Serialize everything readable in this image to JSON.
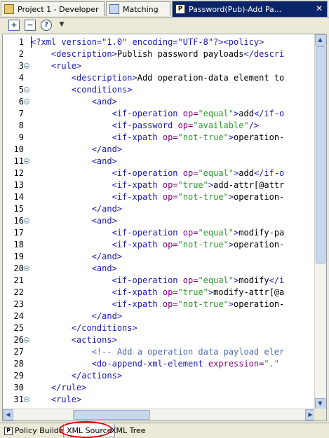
{
  "tabs": [
    {
      "label": "Project 1 - Developer",
      "icon": "project-icon"
    },
    {
      "label": "Matching",
      "icon": "matching-icon"
    },
    {
      "label": "Password(Pub)-Add Pa...",
      "icon": "policy-icon",
      "active": true
    }
  ],
  "toolbar": {
    "icons": [
      "expand-all-icon",
      "collapse-all-icon",
      "help-icon",
      "view-menu-icon"
    ]
  },
  "editor": {
    "lines": [
      {
        "n": "1",
        "fold": false
      },
      {
        "n": "2",
        "fold": false
      },
      {
        "n": "3",
        "fold": true
      },
      {
        "n": "4",
        "fold": false
      },
      {
        "n": "5",
        "fold": true
      },
      {
        "n": "6",
        "fold": true
      },
      {
        "n": "7",
        "fold": false
      },
      {
        "n": "8",
        "fold": false
      },
      {
        "n": "9",
        "fold": false
      },
      {
        "n": "10",
        "fold": false
      },
      {
        "n": "11",
        "fold": true
      },
      {
        "n": "12",
        "fold": false
      },
      {
        "n": "13",
        "fold": false
      },
      {
        "n": "14",
        "fold": false
      },
      {
        "n": "15",
        "fold": false
      },
      {
        "n": "16",
        "fold": true
      },
      {
        "n": "17",
        "fold": false
      },
      {
        "n": "18",
        "fold": false
      },
      {
        "n": "19",
        "fold": false
      },
      {
        "n": "20",
        "fold": true
      },
      {
        "n": "21",
        "fold": false
      },
      {
        "n": "22",
        "fold": false
      },
      {
        "n": "23",
        "fold": false
      },
      {
        "n": "24",
        "fold": false
      },
      {
        "n": "25",
        "fold": false
      },
      {
        "n": "26",
        "fold": true
      },
      {
        "n": "27",
        "fold": false
      },
      {
        "n": "28",
        "fold": false
      },
      {
        "n": "29",
        "fold": false
      },
      {
        "n": "30",
        "fold": false
      },
      {
        "n": "31",
        "fold": true
      }
    ],
    "code": [
      [
        [
          "t",
          "<?xml version=\"1.0\" encoding=\"UTF-8\"?><policy>"
        ]
      ],
      [
        [
          "s",
          "    "
        ],
        [
          "t",
          "<description>"
        ],
        [
          "x",
          "Publish password payloads"
        ],
        [
          "t",
          "</descri"
        ]
      ],
      [
        [
          "s",
          "    "
        ],
        [
          "t",
          "<rule>"
        ]
      ],
      [
        [
          "s",
          "        "
        ],
        [
          "t",
          "<description>"
        ],
        [
          "x",
          "Add operation-data element to"
        ]
      ],
      [
        [
          "s",
          "        "
        ],
        [
          "t",
          "<conditions>"
        ]
      ],
      [
        [
          "s",
          "            "
        ],
        [
          "t",
          "<and>"
        ]
      ],
      [
        [
          "s",
          "                "
        ],
        [
          "t",
          "<if-operation "
        ],
        [
          "a",
          "op="
        ],
        [
          "v",
          "\"equal\""
        ],
        [
          "t",
          ">"
        ],
        [
          "x",
          "add"
        ],
        [
          "t",
          "</if-o"
        ]
      ],
      [
        [
          "s",
          "                "
        ],
        [
          "t",
          "<if-password "
        ],
        [
          "a",
          "op="
        ],
        [
          "v",
          "\"available\""
        ],
        [
          "t",
          "/>"
        ]
      ],
      [
        [
          "s",
          "                "
        ],
        [
          "t",
          "<if-xpath "
        ],
        [
          "a",
          "op="
        ],
        [
          "v",
          "\"not-true\""
        ],
        [
          "t",
          ">"
        ],
        [
          "x",
          "operation-"
        ]
      ],
      [
        [
          "s",
          "            "
        ],
        [
          "t",
          "</and>"
        ]
      ],
      [
        [
          "s",
          "            "
        ],
        [
          "t",
          "<and>"
        ]
      ],
      [
        [
          "s",
          "                "
        ],
        [
          "t",
          "<if-operation "
        ],
        [
          "a",
          "op="
        ],
        [
          "v",
          "\"equal\""
        ],
        [
          "t",
          ">"
        ],
        [
          "x",
          "add"
        ],
        [
          "t",
          "</if-o"
        ]
      ],
      [
        [
          "s",
          "                "
        ],
        [
          "t",
          "<if-xpath "
        ],
        [
          "a",
          "op="
        ],
        [
          "v",
          "\"true\""
        ],
        [
          "t",
          ">"
        ],
        [
          "x",
          "add-attr[@attr"
        ]
      ],
      [
        [
          "s",
          "                "
        ],
        [
          "t",
          "<if-xpath "
        ],
        [
          "a",
          "op="
        ],
        [
          "v",
          "\"not-true\""
        ],
        [
          "t",
          ">"
        ],
        [
          "x",
          "operation-"
        ]
      ],
      [
        [
          "s",
          "            "
        ],
        [
          "t",
          "</and>"
        ]
      ],
      [
        [
          "s",
          "            "
        ],
        [
          "t",
          "<and>"
        ]
      ],
      [
        [
          "s",
          "                "
        ],
        [
          "t",
          "<if-operation "
        ],
        [
          "a",
          "op="
        ],
        [
          "v",
          "\"equal\""
        ],
        [
          "t",
          ">"
        ],
        [
          "x",
          "modify-pa"
        ]
      ],
      [
        [
          "s",
          "                "
        ],
        [
          "t",
          "<if-xpath "
        ],
        [
          "a",
          "op="
        ],
        [
          "v",
          "\"not-true\""
        ],
        [
          "t",
          ">"
        ],
        [
          "x",
          "operation-"
        ]
      ],
      [
        [
          "s",
          "            "
        ],
        [
          "t",
          "</and>"
        ]
      ],
      [
        [
          "s",
          "            "
        ],
        [
          "t",
          "<and>"
        ]
      ],
      [
        [
          "s",
          "                "
        ],
        [
          "t",
          "<if-operation "
        ],
        [
          "a",
          "op="
        ],
        [
          "v",
          "\"equal\""
        ],
        [
          "t",
          ">"
        ],
        [
          "x",
          "modify"
        ],
        [
          "t",
          "</i"
        ]
      ],
      [
        [
          "s",
          "                "
        ],
        [
          "t",
          "<if-xpath "
        ],
        [
          "a",
          "op="
        ],
        [
          "v",
          "\"true\""
        ],
        [
          "t",
          ">"
        ],
        [
          "x",
          "modify-attr[@a"
        ]
      ],
      [
        [
          "s",
          "                "
        ],
        [
          "t",
          "<if-xpath "
        ],
        [
          "a",
          "op="
        ],
        [
          "v",
          "\"not-true\""
        ],
        [
          "t",
          ">"
        ],
        [
          "x",
          "operation-"
        ]
      ],
      [
        [
          "s",
          "            "
        ],
        [
          "t",
          "</and>"
        ]
      ],
      [
        [
          "s",
          "        "
        ],
        [
          "t",
          "</conditions>"
        ]
      ],
      [
        [
          "s",
          "        "
        ],
        [
          "t",
          "<actions>"
        ]
      ],
      [
        [
          "s",
          "            "
        ],
        [
          "c",
          "<!-- Add a operation data payload eler"
        ]
      ],
      [
        [
          "s",
          "            "
        ],
        [
          "t",
          "<do-append-xml-element "
        ],
        [
          "a",
          "expression="
        ],
        [
          "v",
          "\".\""
        ]
      ],
      [
        [
          "s",
          "        "
        ],
        [
          "t",
          "</actions>"
        ]
      ],
      [
        [
          "s",
          "    "
        ],
        [
          "t",
          "</rule>"
        ]
      ],
      [
        [
          "s",
          "    "
        ],
        [
          "t",
          "<rule>"
        ]
      ]
    ]
  },
  "bottom_tabs": [
    {
      "label": "Policy Builder",
      "icon": "policy-builder-icon"
    },
    {
      "label": "XML Source",
      "active": true
    },
    {
      "label": "XML Tree"
    }
  ],
  "colors": {
    "tag": "#1a1ab4",
    "attr": "#7f007f",
    "value": "#2a9a2a",
    "comment": "#4a6ab4",
    "highlight": "#e00000"
  }
}
